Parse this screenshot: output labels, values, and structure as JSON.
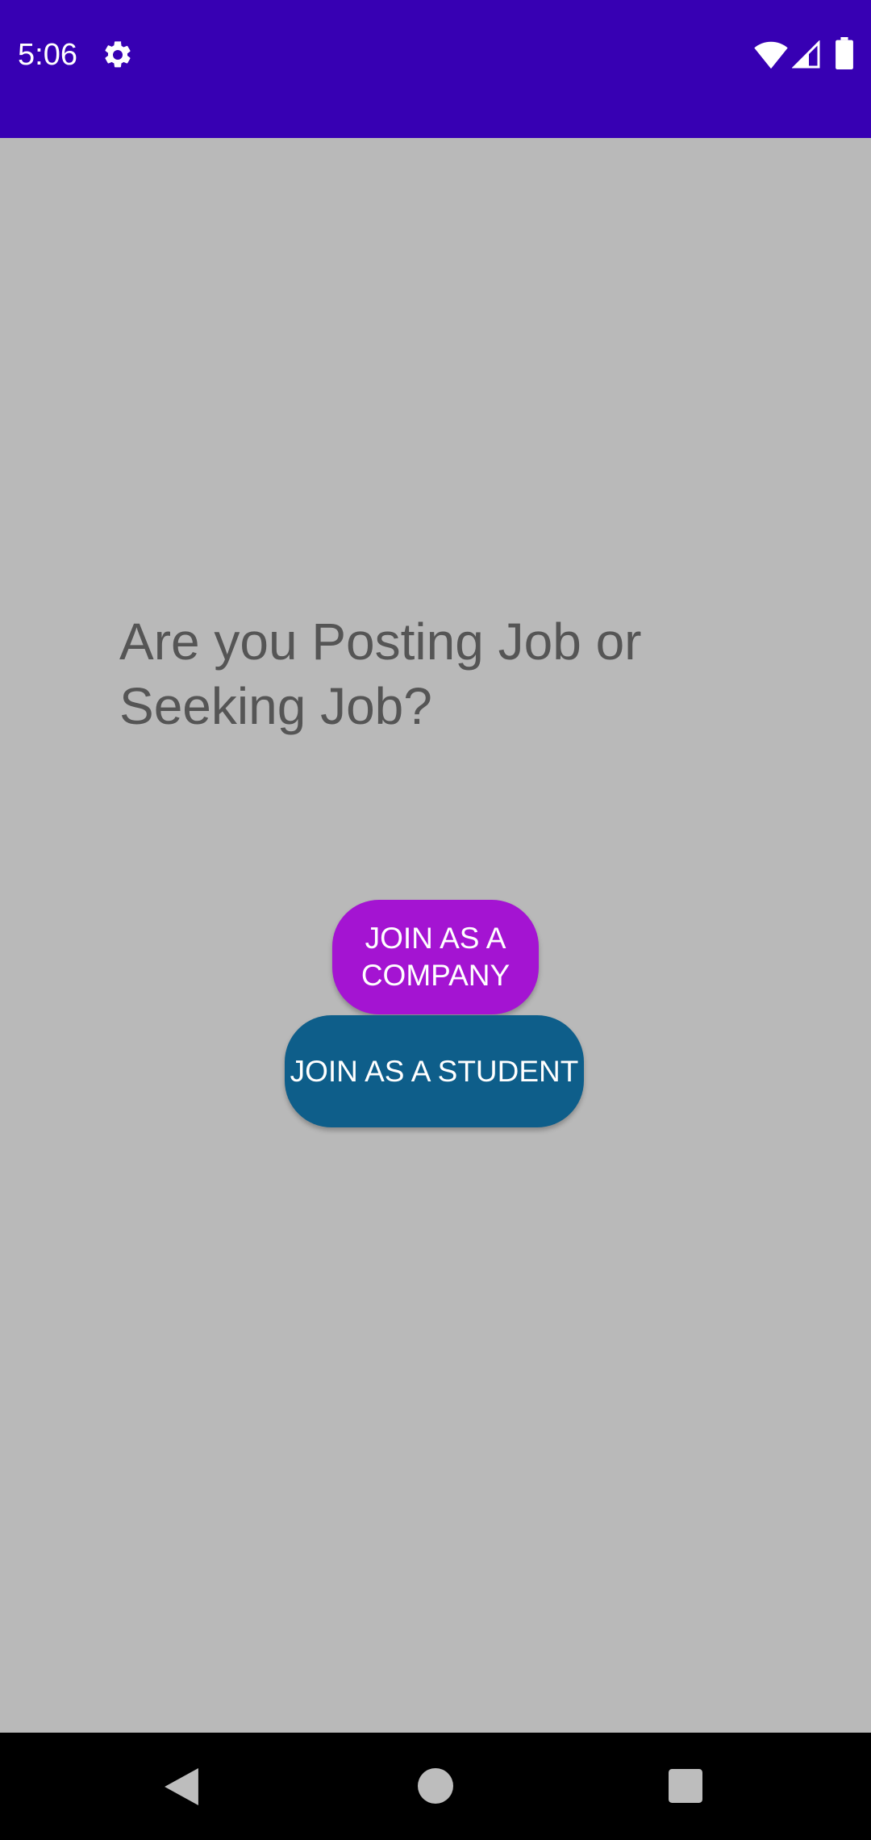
{
  "status_bar": {
    "time": "5:06",
    "icons": [
      "gear-icon",
      "wifi-icon",
      "signal-icon",
      "battery-icon"
    ],
    "background": "#3700b3"
  },
  "main": {
    "question": "Are you Posting Job or Seeking Job?",
    "company_button_label": "JOIN AS A COMPANY",
    "student_button_label": "JOIN AS A STUDENT",
    "company_button_color": "#a414d2",
    "student_button_color": "#0e5e8a",
    "background": "#b9b9b9"
  },
  "nav_bar": {
    "icons": [
      "nav-back-icon",
      "nav-home-icon",
      "nav-recents-icon"
    ]
  }
}
